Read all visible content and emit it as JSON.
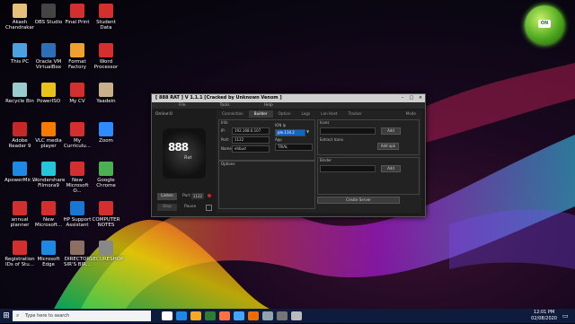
{
  "desktop": {
    "icons": [
      {
        "label": "Akash\nChandrakar",
        "color": "#e6c07b"
      },
      {
        "label": "OBS Studio",
        "color": "#444"
      },
      {
        "label": "Final Print",
        "color": "#d32f2f"
      },
      {
        "label": "Student Data",
        "color": "#d32f2f"
      },
      {
        "label": "This PC",
        "color": "#4aa3df"
      },
      {
        "label": "Oracle VM\nVirtualBox",
        "color": "#2d6fb6"
      },
      {
        "label": "Format\nFactory",
        "color": "#f0a030"
      },
      {
        "label": "Word\nProcessor",
        "color": "#d32f2f"
      },
      {
        "label": "Recycle Bin",
        "color": "#9cc"
      },
      {
        "label": "PowerISO",
        "color": "#e8c21a"
      },
      {
        "label": "My CV",
        "color": "#d32f2f"
      },
      {
        "label": "Yaadein",
        "color": "#c8b08a"
      },
      {
        "label": "Adobe\nReader 9",
        "color": "#c62828"
      },
      {
        "label": "VLC media\nplayer",
        "color": "#f57c00"
      },
      {
        "label": "My\nCurriculu...",
        "color": "#d32f2f"
      },
      {
        "label": "Zoom",
        "color": "#2d8cff"
      },
      {
        "label": "ApowerMir...",
        "color": "#1e88e5"
      },
      {
        "label": "Wondershare\nFilmora9",
        "color": "#26c6da"
      },
      {
        "label": "New\nMicrosoft O...",
        "color": "#d32f2f"
      },
      {
        "label": "Google\nChrome",
        "color": "#4caf50"
      },
      {
        "label": "annual\nplanner",
        "color": "#d32f2f"
      },
      {
        "label": "New\nMicrosoft...",
        "color": "#d32f2f"
      },
      {
        "label": "HP Support\nAssistant",
        "color": "#1976d2"
      },
      {
        "label": "COMPUTER\nNOTES",
        "color": "#d32f2f"
      },
      {
        "label": "Registration\nIDs of Stu...",
        "color": "#d32f2f"
      },
      {
        "label": "Microsoft\nEdge",
        "color": "#1e88e5"
      },
      {
        "label": "DIRECTOR\nSIR'S BIR...",
        "color": "#8d6e63"
      },
      {
        "label": "SECURESHOP",
        "color": "#888"
      }
    ]
  },
  "window": {
    "title": "[ 888 RAT ] V 1.1.1 [Cracked by Unknown Venom ]",
    "menu": [
      "File",
      "Tools",
      "Help"
    ],
    "online_label": "Online:0",
    "logo_text": "888",
    "logo_sub": "Rat",
    "listen_label": "Listen",
    "port_label": "Port",
    "port_value": "1122",
    "stop_label": "Stop",
    "pause_label": "Pause",
    "tabs": [
      "Connection",
      "Builder",
      "Option",
      "Logs",
      "Lan Host",
      "Tracker"
    ],
    "mode_label": "Mode",
    "info": {
      "header": "Info",
      "ip_label": "IP:",
      "ip_value": "192.168.0.107",
      "port_label": "Port:",
      "port_value": "1122",
      "name_label": "Name:",
      "name_value": "ehbud",
      "ion_label": "ION Ip",
      "ion_value": "ple.110.2",
      "app_label": "App",
      "app_value": "TRIAL",
      "options_label": "Options"
    },
    "icons_panel": {
      "header": "Icons",
      "extract_label": "Extract Icons",
      "add_label": "Add",
      "add_apk_label": "Add apk"
    },
    "binder_panel": {
      "header": "Binder",
      "add_label": "Add"
    },
    "create_server_label": "Create Server"
  },
  "taskbar": {
    "search_placeholder": "Type here to search",
    "time": "12:01 PM",
    "date": "02/08/2020",
    "app_colors": [
      "#fff",
      "#1e88e5",
      "#f9a825",
      "#2e7d32",
      "#ff7043",
      "#42a5f5",
      "#ef6c00",
      "#90a4ae",
      "#757575",
      "#bbb"
    ]
  }
}
